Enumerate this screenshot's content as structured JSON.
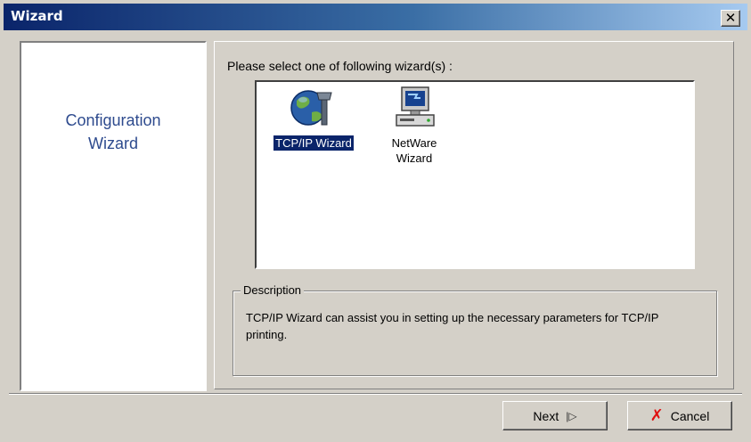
{
  "window": {
    "title": "Wizard",
    "close_glyph": "✕"
  },
  "left_panel": {
    "title": "Configuration\nWizard"
  },
  "main": {
    "prompt": "Please select one of following wizard(s) :",
    "wizards": [
      {
        "label": "TCP/IP Wizard",
        "icon": "globe-network-icon",
        "selected": true
      },
      {
        "label": "NetWare\nWizard",
        "icon": "computer-monitor-icon",
        "selected": false
      }
    ]
  },
  "description": {
    "legend": "Description",
    "text": "TCP/IP Wizard can assist you in setting up the necessary parameters for TCP/IP printing."
  },
  "buttons": {
    "next_label": "Next",
    "cancel_label": "Cancel"
  },
  "colors": {
    "title_bar": "#0a246a",
    "selection": "#0a246a",
    "cancel_icon": "#e01010",
    "config_title": "#2e4b8e"
  }
}
